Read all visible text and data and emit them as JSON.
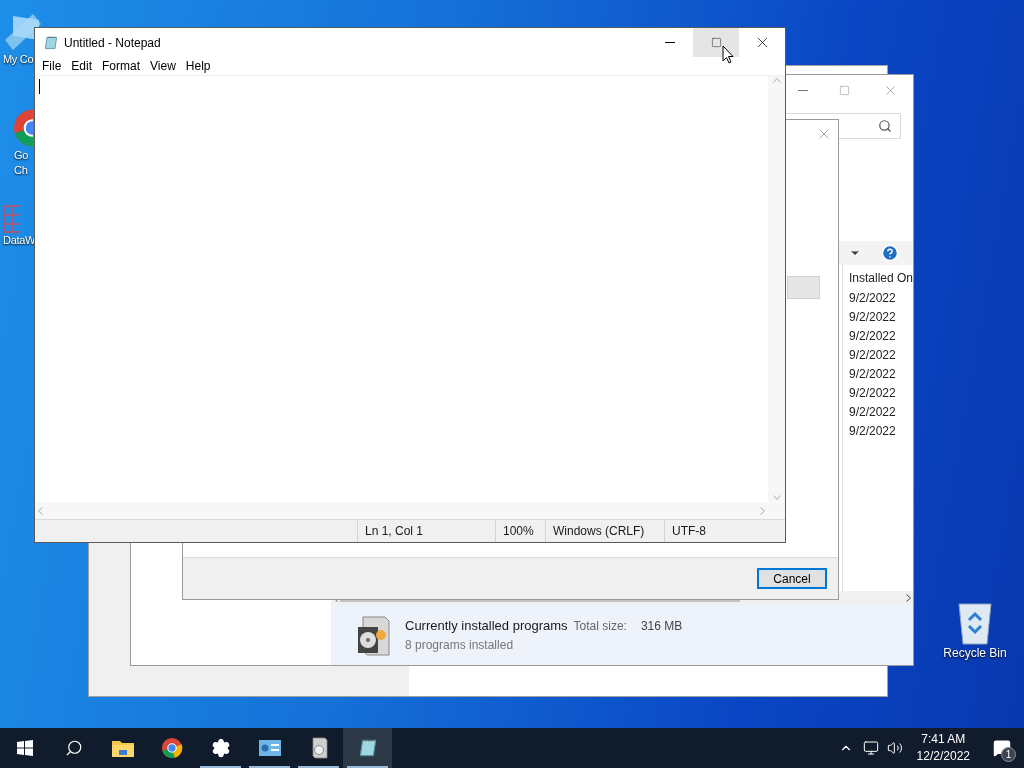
{
  "desktop_icons": [
    {
      "kind": "folder",
      "lines": [
        "My Co"
      ]
    },
    {
      "kind": "chrome",
      "lines": [
        "Go",
        "Ch"
      ]
    },
    {
      "kind": "data",
      "lines": [
        "DataW"
      ]
    },
    {
      "kind": "recycle",
      "lines": [
        "Recycle Bin"
      ]
    }
  ],
  "programs_window": {
    "column": "Installed On",
    "rows": [
      "9/2/2022",
      "9/2/2022",
      "9/2/2022",
      "9/2/2022",
      "9/2/2022",
      "9/2/2022",
      "9/2/2022",
      "9/2/2022"
    ],
    "details": {
      "title": "Currently installed programs",
      "size_label": "Total size:",
      "size": "316 MB",
      "count": "8 programs installed"
    }
  },
  "dialog": {
    "buttons": [
      {
        "label": "Cancel",
        "default": true
      }
    ]
  },
  "notepad": {
    "title": "Untitled - Notepad",
    "menu": [
      "File",
      "Edit",
      "Format",
      "View",
      "Help"
    ],
    "window_controls": [
      {
        "kind": "minimize",
        "hovered": false
      },
      {
        "kind": "maximize",
        "hovered": true
      },
      {
        "kind": "close",
        "hovered": false
      }
    ],
    "status_bar": [
      "Ln 1, Col 1",
      "100%",
      "Windows (CRLF)",
      "UTF-8"
    ]
  },
  "taskbar": {
    "items": [
      {
        "kind": "start",
        "running": false,
        "selected": false
      },
      {
        "kind": "search",
        "running": false,
        "selected": false
      },
      {
        "kind": "explorer",
        "running": false,
        "selected": false
      },
      {
        "kind": "chrome",
        "running": false,
        "selected": false
      },
      {
        "kind": "settings",
        "running": true,
        "selected": false
      },
      {
        "kind": "control",
        "running": true,
        "selected": false
      },
      {
        "kind": "programs",
        "running": true,
        "selected": false
      },
      {
        "kind": "notepad",
        "running": true,
        "selected": true
      }
    ],
    "time": "7:41 AM",
    "date": "12/2/2022",
    "notification_count": "1"
  }
}
